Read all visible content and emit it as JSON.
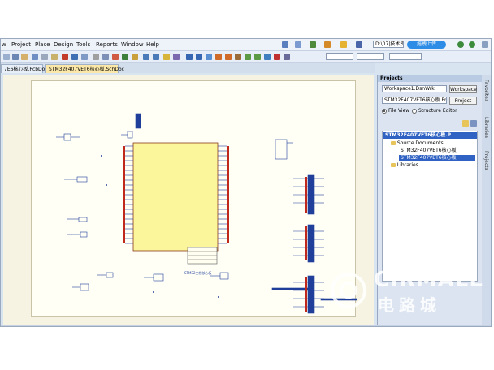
{
  "menu": [
    "w",
    "Project",
    "Place",
    "Design",
    "Tools",
    "Reports",
    "Window",
    "Help"
  ],
  "toolbar": {
    "path_combo": "D:\\07|技术资",
    "upload_label": "拖拽上传"
  },
  "tabs": [
    {
      "label": "7E6核心板.PcbDoc",
      "active": false
    },
    {
      "label": "STM32F407VET6核心板.SchDoc",
      "active": true
    }
  ],
  "schematic": {
    "title_block_caption": "STM32工程核心板"
  },
  "projects_panel": {
    "title": "Projects",
    "workspace_value": "Workspace1.DsnWrk",
    "workspace_button": "Workspace",
    "project_value": "STM32F407VET6核心板.PrjPcb",
    "project_button": "Project",
    "view_file": "File View",
    "view_structure": "Structure Editor",
    "tree": {
      "root": "STM32F407VET6核心板.P",
      "source_folder": "Source Documents",
      "doc1": "STM32F407VET6核心板.",
      "doc2": "STM32F407VET6核心板.",
      "libraries": "Libraries"
    }
  },
  "side_tabs": [
    "Favorites",
    "Libraries",
    "Projects"
  ],
  "watermark": {
    "brand": "CIRMALL",
    "brand_cn": "电路城"
  },
  "colors": {
    "chip_fill": "#fbf59c",
    "wire": "#1f3f9a",
    "pin_red": "#c0281c",
    "accent_blue": "#2d8ce6"
  }
}
